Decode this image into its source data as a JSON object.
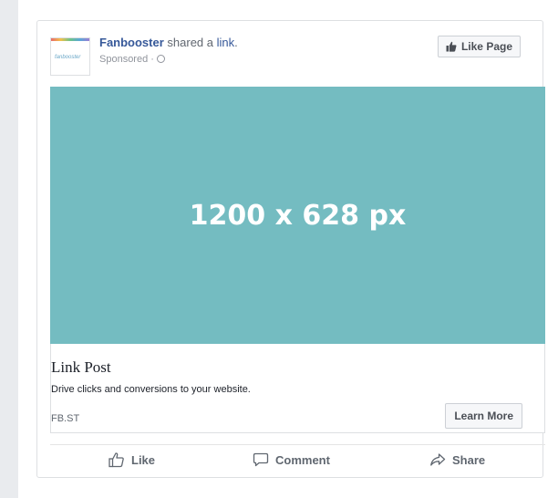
{
  "post": {
    "page_name": "Fanbooster",
    "action_text": " shared a ",
    "link_word": "link",
    "period": ".",
    "sponsored": "Sponsored · ",
    "avatar_wordmark": "fanbooster",
    "like_page_label": "Like Page"
  },
  "image": {
    "placeholder_text": "1200 x 628 px"
  },
  "link": {
    "title": "Link Post",
    "description": "Drive clicks and conversions to your website.",
    "domain": "FB.ST",
    "cta_label": "Learn More"
  },
  "actions": {
    "like": "Like",
    "comment": "Comment",
    "share": "Share"
  },
  "colors": {
    "image_bg": "#74bcc1",
    "link_blue": "#365899"
  }
}
